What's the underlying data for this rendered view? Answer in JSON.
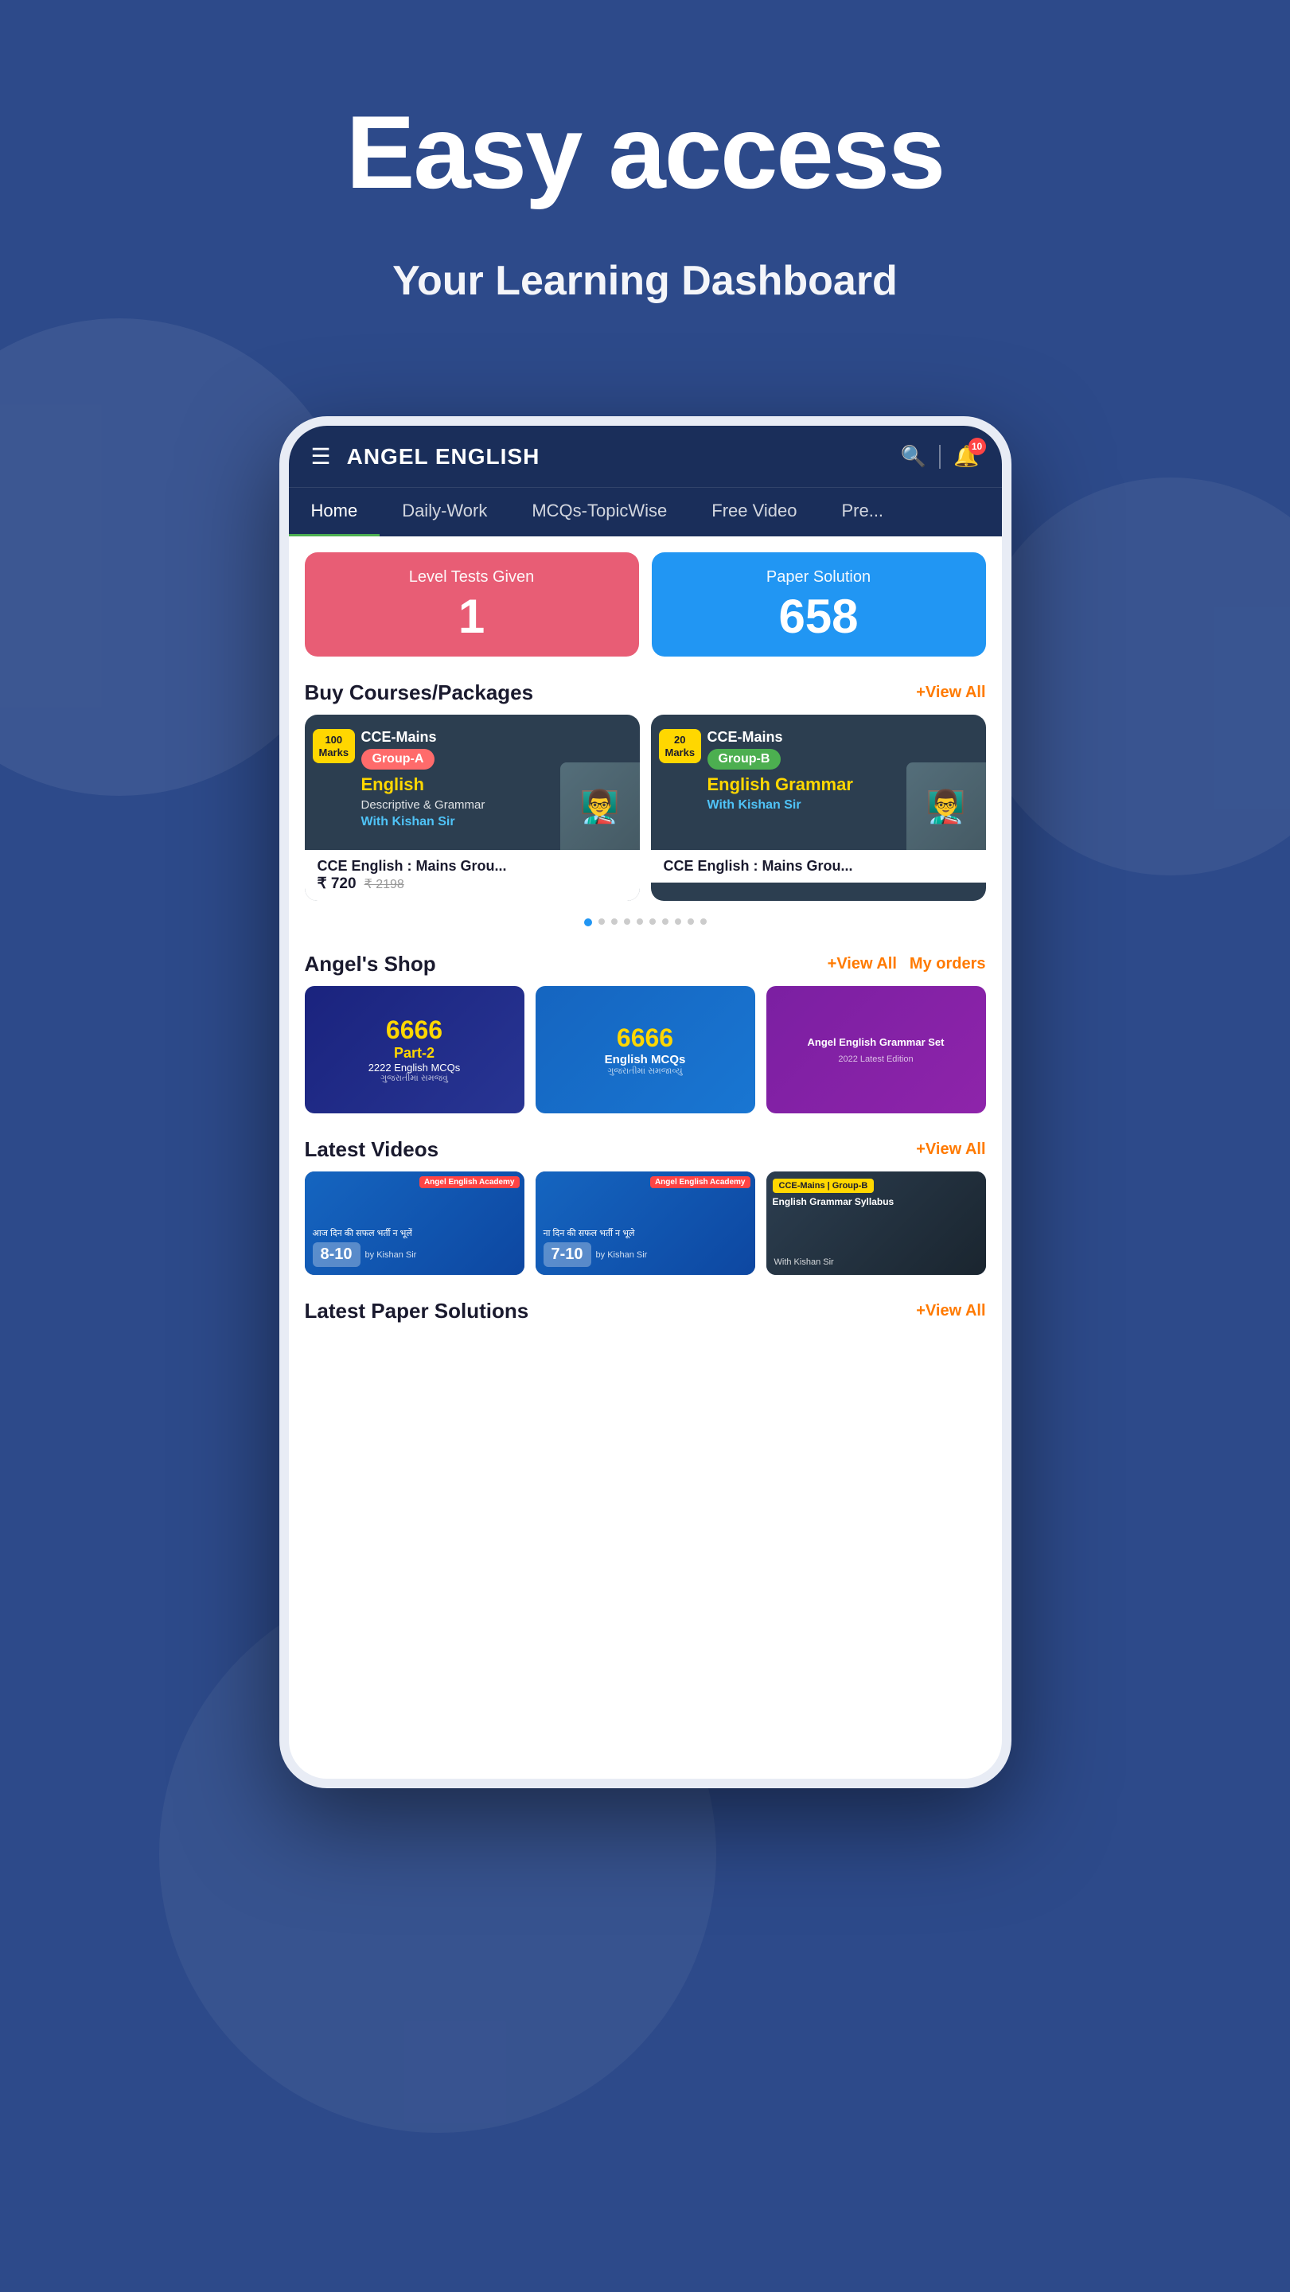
{
  "hero": {
    "title": "Easy access",
    "subtitle": "Your Learning Dashboard"
  },
  "app": {
    "title": "ANGEL ENGLISH",
    "notification_count": "10"
  },
  "nav": {
    "tabs": [
      {
        "label": "Home",
        "active": true
      },
      {
        "label": "Daily-Work",
        "active": false
      },
      {
        "label": "MCQs-TopicWise",
        "active": false
      },
      {
        "label": "Free Video",
        "active": false
      },
      {
        "label": "Pre...",
        "active": false
      }
    ]
  },
  "stats": {
    "level_tests": {
      "label": "Level Tests Given",
      "value": "1"
    },
    "paper_solution": {
      "label": "Paper Solution",
      "value": "658"
    }
  },
  "courses": {
    "section_title": "Buy Courses/Packages",
    "view_all": "+View All",
    "items": [
      {
        "title": "CCE-Mains",
        "group": "Group-A",
        "subject": "English",
        "desc": "Descriptive & Grammar",
        "teacher": "With Kishan Sir",
        "marks": "100 Marks",
        "name": "CCE English : Mains Grou...",
        "price": "₹ 720",
        "original_price": "₹ 2198"
      },
      {
        "title": "CCE-Mains",
        "group": "Group-B",
        "subject": "English Grammar",
        "desc": "",
        "teacher": "With Kishan Sir",
        "marks": "20 Marks",
        "name": "CCE English : Mains Grou...",
        "price": "",
        "original_price": ""
      }
    ]
  },
  "shop": {
    "section_title": "Angel's Shop",
    "view_all": "+View All",
    "my_orders": "My orders",
    "items": [
      {
        "label": "6666 Part-2",
        "sublabel": "2222 English MCQs"
      },
      {
        "label": "6666 English MCQs"
      },
      {
        "label": "Angel English Grammar Set"
      }
    ]
  },
  "videos": {
    "section_title": "Latest Videos",
    "view_all": "+View All",
    "items": [
      {
        "num": "8-10",
        "teacher": "by Kishan Sir"
      },
      {
        "num": "7-10",
        "teacher": "by Kishan Sir"
      },
      {
        "label": "CCE-Mains | Group-B English Grammar Syllabus",
        "teacher": "With Kishan Sir"
      }
    ]
  },
  "paper_solutions": {
    "section_title": "Latest Paper Solutions",
    "view_all": "+View All"
  }
}
